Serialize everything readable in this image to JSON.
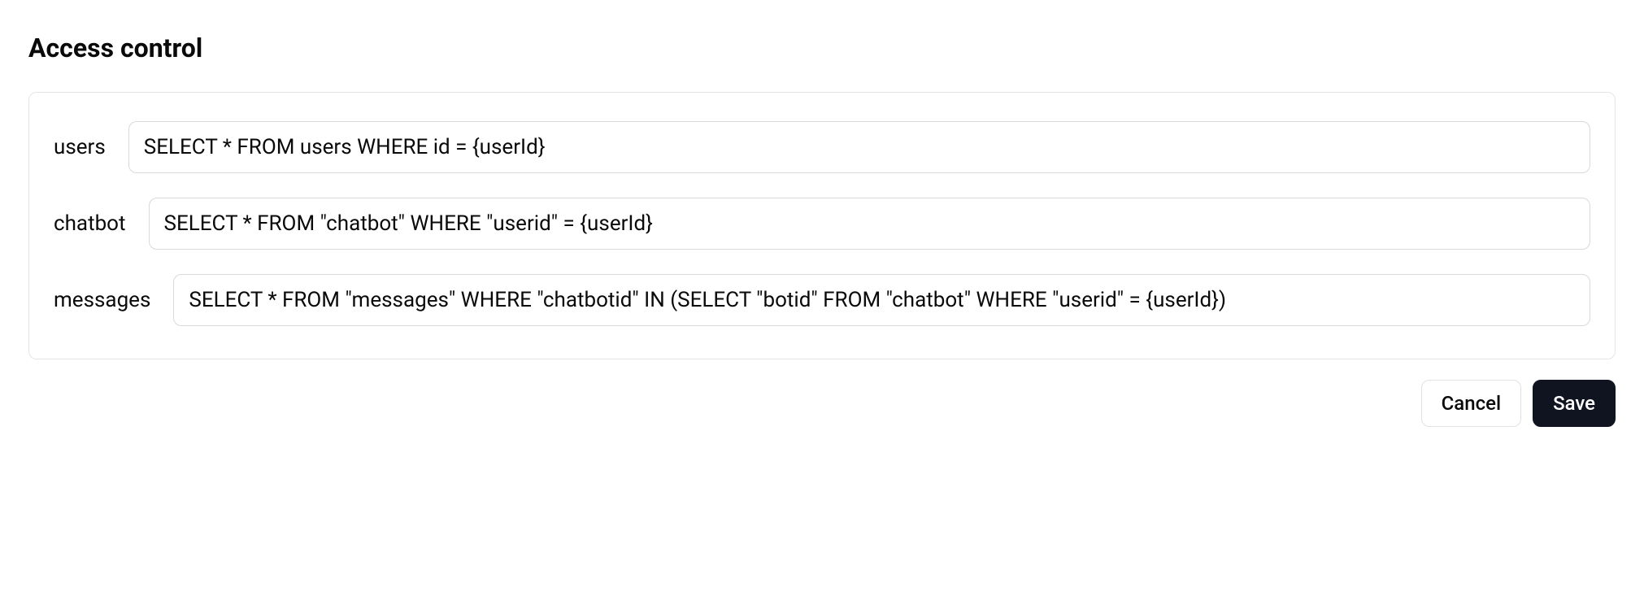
{
  "title": "Access control",
  "rows": [
    {
      "label": "users",
      "value": "SELECT * FROM users WHERE id = {userId}"
    },
    {
      "label": "chatbot",
      "value": "SELECT * FROM \"chatbot\" WHERE \"userid\" = {userId}"
    },
    {
      "label": "messages",
      "value": "SELECT * FROM \"messages\" WHERE \"chatbotid\" IN (SELECT \"botid\" FROM \"chatbot\" WHERE \"userid\" = {userId})"
    }
  ],
  "buttons": {
    "cancel": "Cancel",
    "save": "Save"
  }
}
